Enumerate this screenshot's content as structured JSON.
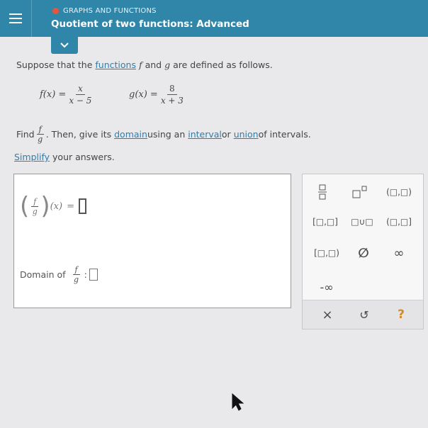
{
  "header": {
    "topic": "GRAPHS AND FUNCTIONS",
    "title": "Quotient of two functions: Advanced",
    "colors": {
      "bar": "#2f86a8",
      "status_dot": "#e8553a"
    }
  },
  "question": {
    "intro_pre": "Suppose that the ",
    "intro_link": "functions",
    "intro_f": "f",
    "intro_and": " and ",
    "intro_g": "g",
    "intro_post": " are defined as follows.",
    "f_label": "f(x) =",
    "f_num": "x",
    "f_den": "x − 5",
    "g_label": "g(x) =",
    "g_num": "8",
    "g_den": "x + 3",
    "find_word": "Find",
    "find_num": "f",
    "find_den": "g",
    "find_mid": ". Then, give its ",
    "domain_link": "domain",
    "using": " using an ",
    "interval_link": "interval",
    "or": " or ",
    "union_link": "union",
    "of_intervals": " of intervals.",
    "simplify_link": "Simplify",
    "simplify_rest": " your answers."
  },
  "answer": {
    "frac_num": "f",
    "frac_den": "g",
    "arg": "(x)",
    "equals": "=",
    "domain_label": "Domain of",
    "domain_num": "f",
    "domain_den": "g",
    "colon": ":"
  },
  "palette": {
    "closed_open": "[□,□)",
    "closed_closed": "[□,□]",
    "open_closed": "(□,□]",
    "open_open": "(□,□)",
    "union": "□∪□",
    "empty_set": "∅",
    "infinity": "∞",
    "neg_infinity": "-∞",
    "clear": "×",
    "undo": "↺",
    "help": "?"
  }
}
